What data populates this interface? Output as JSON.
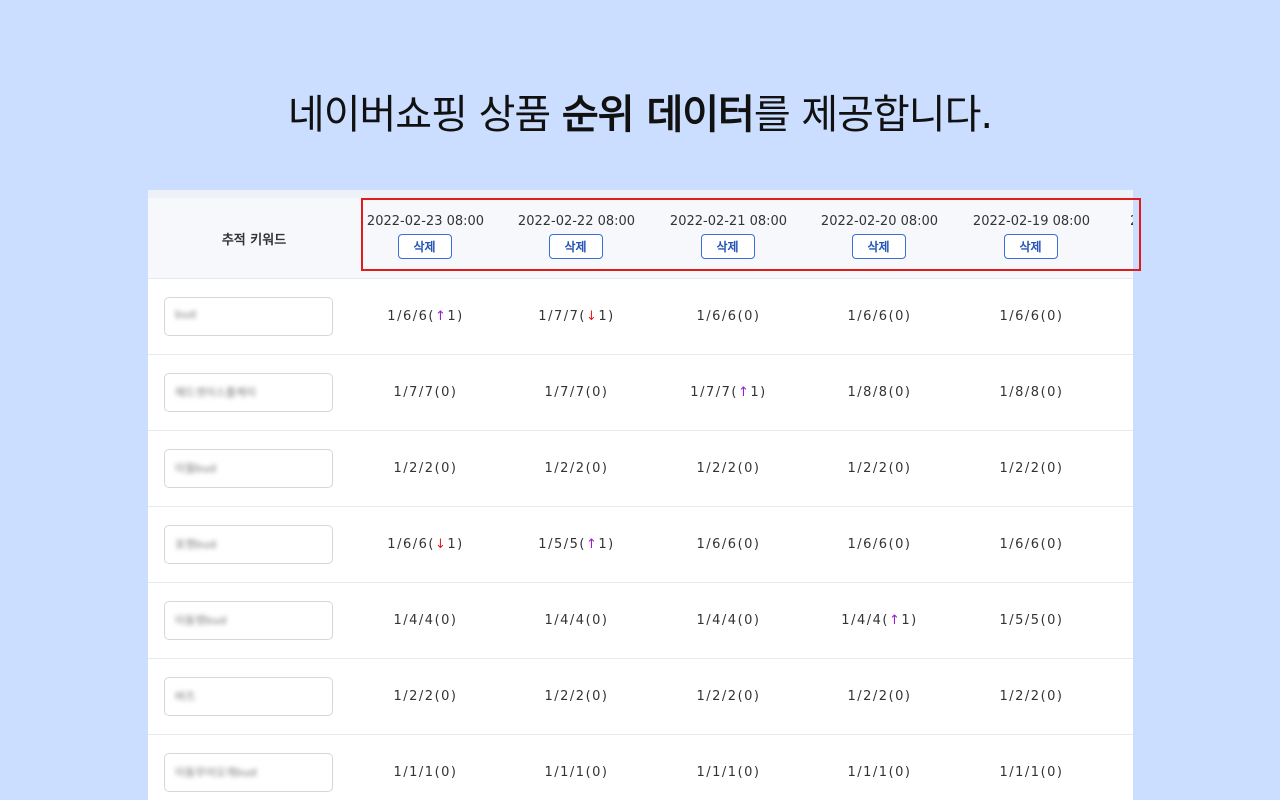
{
  "headline": {
    "part1": "네이버쇼핑 상품 ",
    "bold": "순위 데이터",
    "part2": "를 제공합니다."
  },
  "table": {
    "keyword_header": "추적 키워드",
    "delete_label": "삭제",
    "dates": [
      "2022-02-23 08:00",
      "2022-02-22 08:00",
      "2022-02-21 08:00",
      "2022-02-20 08:00",
      "2022-02-19 08:00"
    ],
    "partial_date": "2",
    "rows": [
      {
        "keyword": "bud",
        "cells": [
          {
            "base": "1/6/6(",
            "arrow": "↑",
            "dir": "up",
            "delta": "1)"
          },
          {
            "base": "1/7/7(",
            "arrow": "↓",
            "dir": "down",
            "delta": "1)"
          },
          {
            "base": "1/6/6(0)"
          },
          {
            "base": "1/6/6(0)"
          },
          {
            "base": "1/6/6(0)"
          }
        ]
      },
      {
        "keyword": "헤드셋이스폴케이",
        "cells": [
          {
            "base": "1/7/7(0)"
          },
          {
            "base": "1/7/7(0)"
          },
          {
            "base": "1/7/7(",
            "arrow": "↑",
            "dir": "up",
            "delta": "1)"
          },
          {
            "base": "1/8/8(0)"
          },
          {
            "base": "1/8/8(0)"
          }
        ]
      },
      {
        "keyword": "이월bud",
        "cells": [
          {
            "base": "1/2/2(0)"
          },
          {
            "base": "1/2/2(0)"
          },
          {
            "base": "1/2/2(0)"
          },
          {
            "base": "1/2/2(0)"
          },
          {
            "base": "1/2/2(0)"
          }
        ]
      },
      {
        "keyword": "포켓bud",
        "cells": [
          {
            "base": "1/6/6(",
            "arrow": "↓",
            "dir": "down",
            "delta": "1)"
          },
          {
            "base": "1/5/5(",
            "arrow": "↑",
            "dir": "up",
            "delta": "1)"
          },
          {
            "base": "1/6/6(0)"
          },
          {
            "base": "1/6/6(0)"
          },
          {
            "base": "1/6/6(0)"
          }
        ]
      },
      {
        "keyword": "이동렛bud",
        "cells": [
          {
            "base": "1/4/4(0)"
          },
          {
            "base": "1/4/4(0)"
          },
          {
            "base": "1/4/4(0)"
          },
          {
            "base": "1/4/4(",
            "arrow": "↑",
            "dir": "up",
            "delta": "1)"
          },
          {
            "base": "1/5/5(0)"
          }
        ]
      },
      {
        "keyword": "버즈",
        "cells": [
          {
            "base": "1/2/2(0)"
          },
          {
            "base": "1/2/2(0)"
          },
          {
            "base": "1/2/2(0)"
          },
          {
            "base": "1/2/2(0)"
          },
          {
            "base": "1/2/2(0)"
          }
        ]
      },
      {
        "keyword": "이동무어오게bud",
        "cells": [
          {
            "base": "1/1/1(0)"
          },
          {
            "base": "1/1/1(0)"
          },
          {
            "base": "1/1/1(0)"
          },
          {
            "base": "1/1/1(0)"
          },
          {
            "base": "1/1/1(0)"
          }
        ]
      }
    ]
  },
  "colors": {
    "background": "#cbdeff",
    "highlight_border": "#e01b1b",
    "button_border": "#3b6fd6",
    "rank_up": "#9b1bd6",
    "rank_down": "#e02020"
  }
}
